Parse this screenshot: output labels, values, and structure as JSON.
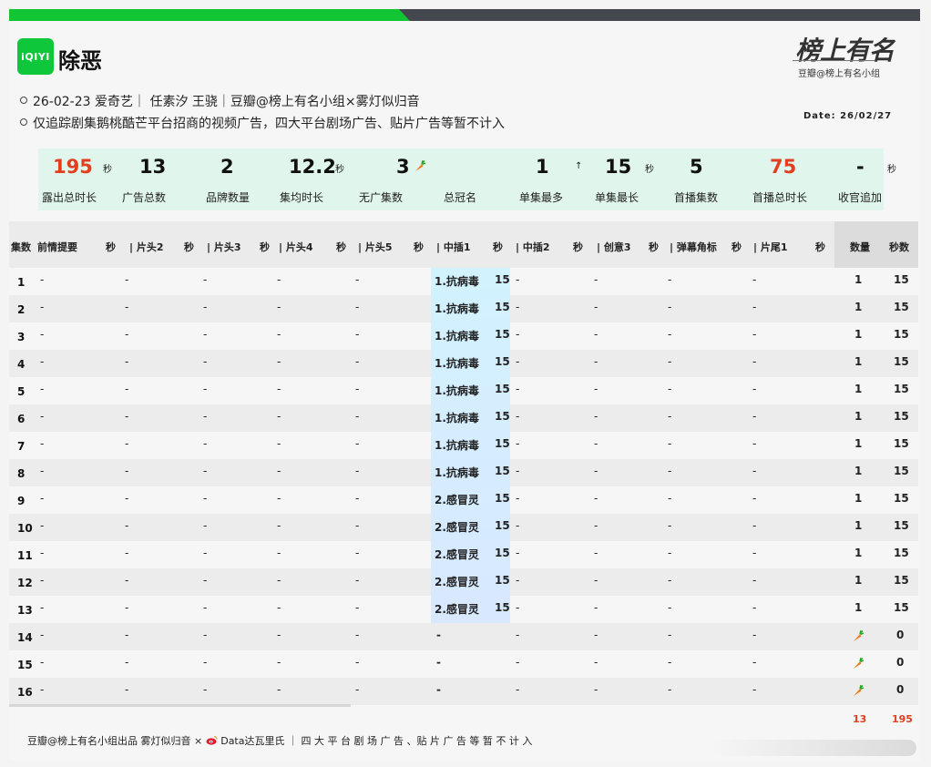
{
  "header": {
    "platform_logo": "iQIYI",
    "title": "除恶",
    "brand_script": "榜上有名",
    "brand_sub": "豆瓣@榜上有名小组",
    "meta_line1": "26-02-23 爱奇艺｜ 任素汐 王骁｜豆瓣@榜上有名小组×雾灯似归音",
    "meta_line2": "仅追踪剧集鹅桃酷芒平台招商的视频广告，四大平台剧场广告、贴片广告等暂不计入",
    "date": "Date: 26/02/27"
  },
  "stats": [
    {
      "value": "195",
      "unit": "秒",
      "label": "露出总时长",
      "color": "#e23f1f"
    },
    {
      "value": "13",
      "unit": "",
      "label": "广告总数"
    },
    {
      "value": "2",
      "unit": "",
      "label": "品牌数量"
    },
    {
      "value": "12.2",
      "unit": "秒",
      "label": "集均时长"
    },
    {
      "value": "3",
      "unit": "",
      "label": "无广集数",
      "icon": "carrot-icon"
    },
    {
      "value": "",
      "unit": "",
      "label": "总冠名"
    },
    {
      "value": "1",
      "unit": "↑",
      "label": "单集最多"
    },
    {
      "value": "15",
      "unit": "秒",
      "label": "单集最长"
    },
    {
      "value": "5",
      "unit": "",
      "label": "首播集数"
    },
    {
      "value": "75",
      "unit": "",
      "label": "首播总时长",
      "color": "#e23f1f"
    },
    {
      "value": "-",
      "unit": "",
      "label": "收官追加"
    }
  ],
  "stats_tail_unit": "秒",
  "table": {
    "headers": [
      "集数",
      "前情提要",
      "秒",
      "| 片头2",
      "秒",
      "| 片头3",
      "秒",
      "| 片头4",
      "秒",
      "| 片头5",
      "秒",
      "| 中插1",
      "秒",
      "| 中插2",
      "秒",
      "| 创意3",
      "秒",
      "| 弹幕角标",
      "秒",
      "| 片尾1",
      "秒",
      "数量",
      "秒数"
    ],
    "empty": "-",
    "rows": [
      {
        "ep": "1",
        "ad": "1.抗病毒",
        "sec": "15",
        "count": "1",
        "total": "15"
      },
      {
        "ep": "2",
        "ad": "1.抗病毒",
        "sec": "15",
        "count": "1",
        "total": "15"
      },
      {
        "ep": "3",
        "ad": "1.抗病毒",
        "sec": "15",
        "count": "1",
        "total": "15"
      },
      {
        "ep": "4",
        "ad": "1.抗病毒",
        "sec": "15",
        "count": "1",
        "total": "15"
      },
      {
        "ep": "5",
        "ad": "1.抗病毒",
        "sec": "15",
        "count": "1",
        "total": "15"
      },
      {
        "ep": "6",
        "ad": "1.抗病毒",
        "sec": "15",
        "count": "1",
        "total": "15"
      },
      {
        "ep": "7",
        "ad": "1.抗病毒",
        "sec": "15",
        "count": "1",
        "total": "15"
      },
      {
        "ep": "8",
        "ad": "1.抗病毒",
        "sec": "15",
        "count": "1",
        "total": "15"
      },
      {
        "ep": "9",
        "ad": "2.感冒灵",
        "sec": "15",
        "count": "1",
        "total": "15"
      },
      {
        "ep": "10",
        "ad": "2.感冒灵",
        "sec": "15",
        "count": "1",
        "total": "15"
      },
      {
        "ep": "11",
        "ad": "2.感冒灵",
        "sec": "15",
        "count": "1",
        "total": "15"
      },
      {
        "ep": "12",
        "ad": "2.感冒灵",
        "sec": "15",
        "count": "1",
        "total": "15"
      },
      {
        "ep": "13",
        "ad": "2.感冒灵",
        "sec": "15",
        "count": "1",
        "total": "15"
      },
      {
        "ep": "14",
        "ad": "-",
        "sec": "",
        "count": "",
        "total": "0",
        "carrot": true
      },
      {
        "ep": "15",
        "ad": "-",
        "sec": "",
        "count": "",
        "total": "0",
        "carrot": true
      },
      {
        "ep": "16",
        "ad": "-",
        "sec": "",
        "count": "",
        "total": "0",
        "carrot": true
      }
    ],
    "totals": {
      "count": "13",
      "total": "195"
    }
  },
  "footer": {
    "text1": "豆瓣@榜上有名小组出品  雾灯似归音 ×",
    "text2": "Data达瓦里氏 ｜ 四 大 平 台 剧 场 广 告 、贴 片 广 告 等 暂 不 计 入"
  },
  "colors": {
    "accent_green": "#12c535",
    "highlight": "#d2f2fe",
    "red": "#e23f1f"
  }
}
